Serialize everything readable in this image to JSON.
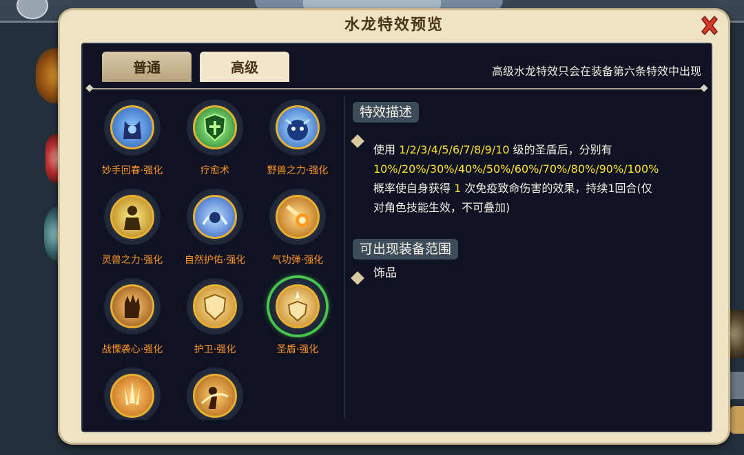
{
  "dialog": {
    "title": "水龙特效预览",
    "tabs": [
      {
        "label": "普通",
        "active": false
      },
      {
        "label": "高级",
        "active": true
      }
    ],
    "notice": "高级水龙特效只会在装备第六条特效中出现"
  },
  "skills": [
    {
      "label": "妙手回春·强化",
      "icon": "cat-healer-icon",
      "color": "#3a7ad8"
    },
    {
      "label": "疗愈术",
      "icon": "green-shield-icon",
      "color": "#2aa838"
    },
    {
      "label": "野兽之力·强化",
      "icon": "beast-face-icon",
      "color": "#2e7ad8"
    },
    {
      "label": "灵兽之力·强化",
      "icon": "beast-spirit-icon",
      "color": "#d8a020"
    },
    {
      "label": "自然护佑·强化",
      "icon": "nature-guard-icon",
      "color": "#3f86e0"
    },
    {
      "label": "气功弹·强化",
      "icon": "fireball-icon",
      "color": "#e08a20"
    },
    {
      "label": "战慄袭心·强化",
      "icon": "dark-hand-icon",
      "color": "#c07020"
    },
    {
      "label": "护卫·强化",
      "icon": "guard-shield-icon",
      "color": "#e0a030"
    },
    {
      "label": "圣盾·强化",
      "icon": "holy-shield-icon",
      "color": "#e0a030",
      "selected": true
    },
    {
      "label": "",
      "icon": "spear-burst-icon",
      "color": "#e0a030"
    },
    {
      "label": "",
      "icon": "spin-strike-icon",
      "color": "#d89020"
    }
  ],
  "detail": {
    "desc_title": "特效描述",
    "desc": {
      "p1": "使用 ",
      "levels": "1/2/3/4/5/6/7/8/9/10",
      "p2": " 级的圣盾后，分别有 ",
      "chances": "10%/20%/30%/40%/50%/60%/70%/80%/90%/100%",
      "p3": " 概率使自身获得 ",
      "count": "1",
      "p4": " 次免疫致命伤害的效果，持续1回合(仅对角色技能生效，不可叠加)"
    },
    "range_title": "可出现装备范围",
    "range": "饰品"
  },
  "colors": {
    "accent_orange": "#ff9320",
    "highlight_yellow": "#ffe02a",
    "selected_green": "#45c64a",
    "close_red": "#d83a2a"
  }
}
